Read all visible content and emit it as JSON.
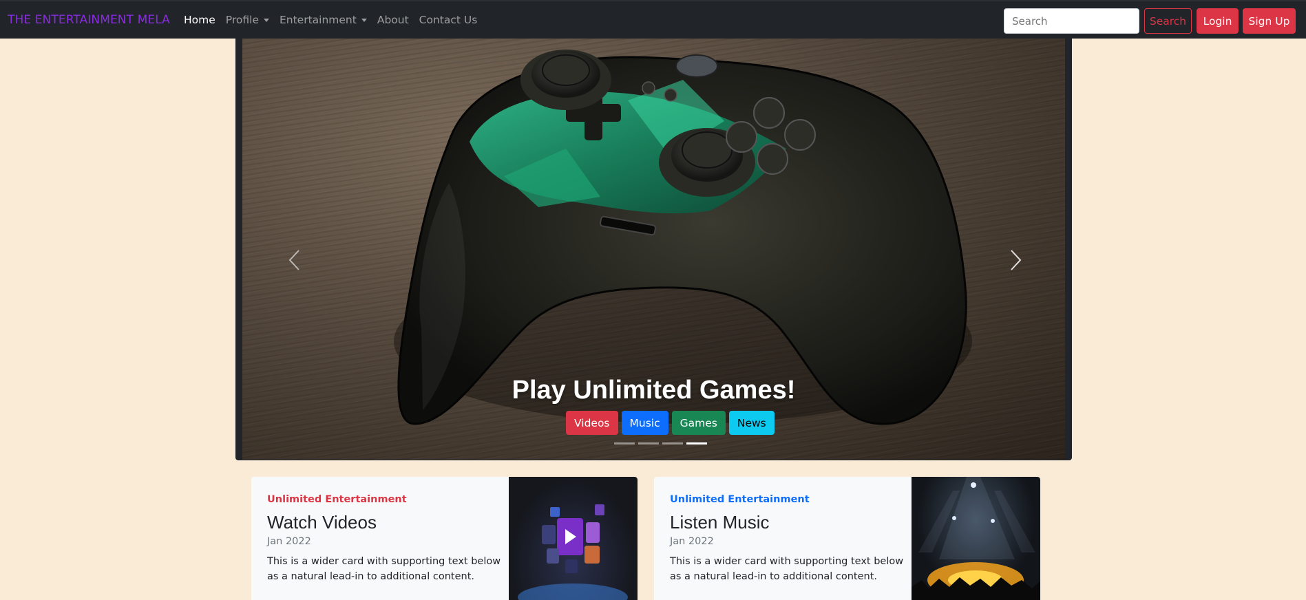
{
  "navbar": {
    "brand": "THE ENTERTAINMENT MELA",
    "links": [
      {
        "label": "Home",
        "active": true
      },
      {
        "label": "Profile",
        "dropdown": true
      },
      {
        "label": "Entertainment",
        "dropdown": true
      },
      {
        "label": "About"
      },
      {
        "label": "Contact Us"
      }
    ],
    "search_placeholder": "Search",
    "search_button": "Search",
    "login_button": "Login",
    "signup_button": "Sign Up"
  },
  "carousel": {
    "caption": "Play Unlimited Games!",
    "buttons": [
      "Videos",
      "Music",
      "Games",
      "News"
    ],
    "indicator_count": 4,
    "active_indicator": 4,
    "prev_icon": "chevron-left-icon",
    "next_icon": "chevron-right-icon"
  },
  "cards": [
    {
      "category": "Unlimited Entertainment",
      "title": "Watch Videos",
      "date": "Jan 2022",
      "text": "This is a wider card with supporting text below as a natural lead-in to additional content."
    },
    {
      "category": "Unlimited Entertainment",
      "title": "Listen Music",
      "date": "Jan 2022",
      "text": "This is a wider card with supporting text below as a natural lead-in to additional content."
    }
  ],
  "colors": {
    "page_bg": "#faebd7",
    "navbar_bg": "#212529",
    "brand": "#8a2be2",
    "danger": "#dc3545",
    "primary": "#0d6efd",
    "success": "#198754",
    "info": "#0dcaf0"
  }
}
